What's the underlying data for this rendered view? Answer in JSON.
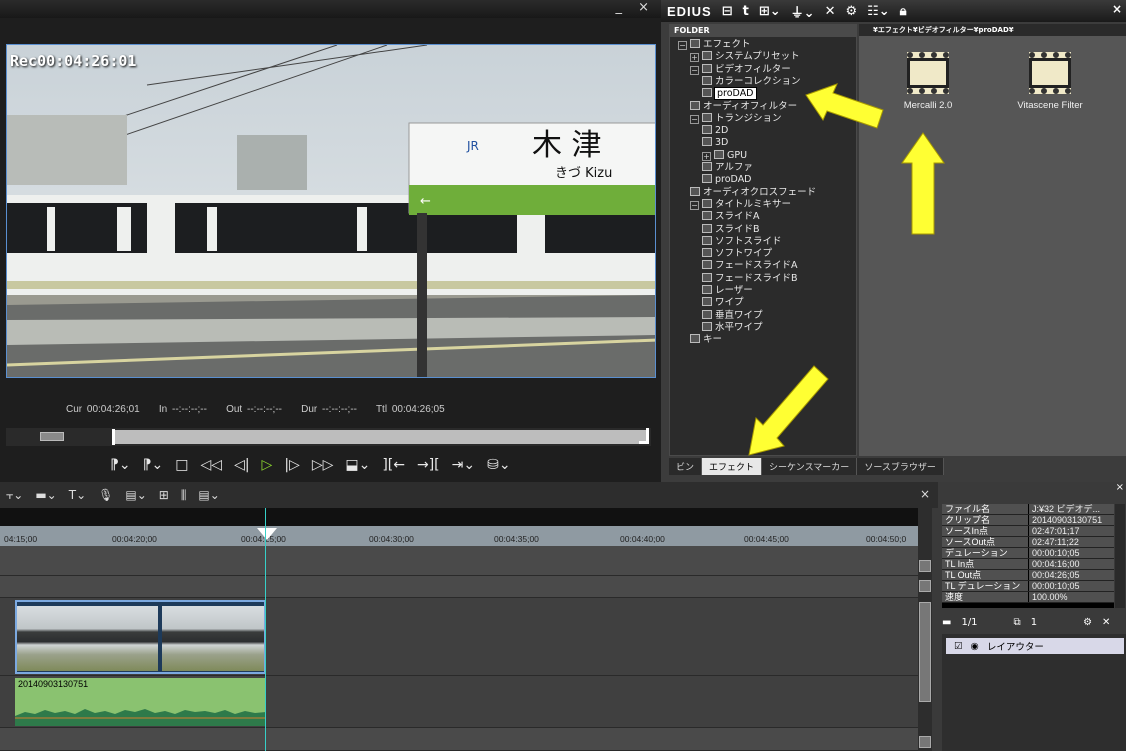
{
  "player": {
    "window_controls": "_ ×",
    "timecode_overlay": "Rec00:04:26:01",
    "cur_label": "Cur",
    "cur_value": "00:04:26;01",
    "in_label": "In",
    "in_value": "--:--:--;--",
    "out_label": "Out",
    "out_value": "--:--:--;--",
    "dur_label": "Dur",
    "dur_value": "--:--:--;--",
    "ttl_label": "Ttl",
    "ttl_value": "00:04:26;05",
    "station_name": "木 津",
    "station_reading": "きづ Kizu"
  },
  "fx_panel": {
    "title": "EDIUS",
    "close": "×",
    "folder_header": "FOLDER",
    "items_header": "¥エフェクト¥ビデオフィルター¥proDAD¥",
    "tree": [
      "エフェクト",
      "システムプリセット",
      "ビデオフィルター",
      "カラーコレクション",
      "proDAD",
      "オーディオフィルター",
      "トランジション",
      "2D",
      "3D",
      "GPU",
      "アルファ",
      "proDAD",
      "オーディオクロスフェード",
      "タイトルミキサー",
      "スライドA",
      "スライドB",
      "ソフトスライド",
      "ソフトワイプ",
      "フェードスライドA",
      "フェードスライドB",
      "レーザー",
      "ワイプ",
      "垂直ワイプ",
      "水平ワイプ",
      "キー"
    ],
    "effects": [
      "Mercalli 2.0",
      "Vitascene Filter"
    ],
    "tabs": [
      "ビン",
      "エフェクト",
      "シーケンスマーカー",
      "ソースブラウザー"
    ]
  },
  "timeline": {
    "close": "×",
    "ruler_labels": [
      "04:15;00",
      "00:04:20;00",
      "00:04:25;00",
      "00:04:30;00",
      "00:04:35;00",
      "00:04:40;00",
      "00:04:45;00",
      "00:04:50;0"
    ],
    "audio_clip_name": "20140903130751"
  },
  "properties": {
    "rows": [
      {
        "k": "ファイル名",
        "v": "J:¥32 ビデオデ..."
      },
      {
        "k": "クリップ名",
        "v": "20140903130751"
      },
      {
        "k": "ソースIn点",
        "v": "02:47:01;17"
      },
      {
        "k": "ソースOut点",
        "v": "02:47:11;22"
      },
      {
        "k": "デュレーション",
        "v": "00:00:10;05"
      },
      {
        "k": "TL In点",
        "v": "00:04:16;00"
      },
      {
        "k": "TL Out点",
        "v": "00:04:26;05"
      },
      {
        "k": "TL デュレーション",
        "v": "00:00:10;05"
      },
      {
        "k": "速度",
        "v": "100.00%"
      }
    ],
    "layer_count": "1/1",
    "layer_num": "1",
    "layer_name": "レイアウター",
    "close": "×"
  },
  "colors": {
    "arrow": "#ffff33",
    "playhead": "#37d0c8",
    "audio_clip": "#8ac270",
    "play_button": "#8fdc2f"
  }
}
